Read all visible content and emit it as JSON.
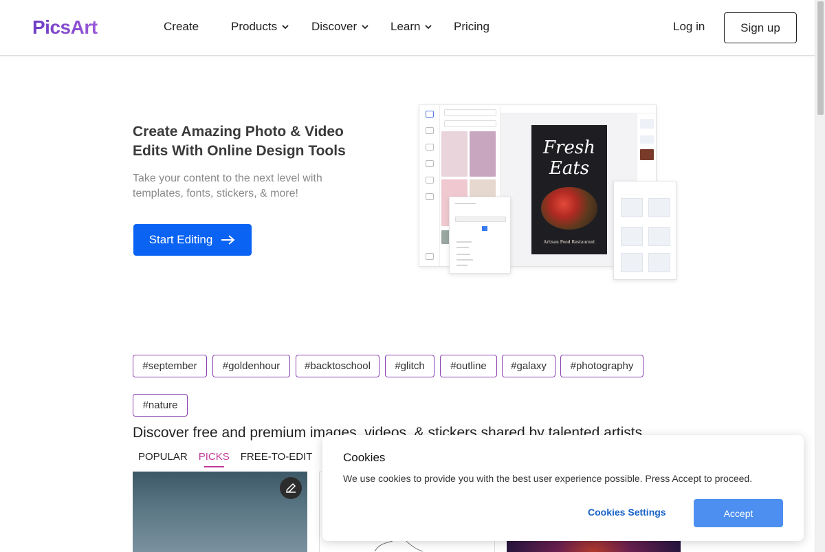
{
  "header": {
    "logo": "PicsArt",
    "nav": [
      {
        "label": "Create",
        "has_dropdown": false
      },
      {
        "label": "Products",
        "has_dropdown": true
      },
      {
        "label": "Discover",
        "has_dropdown": true
      },
      {
        "label": "Learn",
        "has_dropdown": true
      },
      {
        "label": "Pricing",
        "has_dropdown": false
      }
    ],
    "login_label": "Log in",
    "signup_label": "Sign up"
  },
  "hero": {
    "title": "Create Amazing Photo & Video Edits With Online Design Tools",
    "subtitle": "Take your content to the next level with templates, fonts, stickers, & more!",
    "cta_label": "Start Editing",
    "mockup": {
      "poster_title": "Fresh Eats",
      "poster_footer": "Artisan Food Restaurant"
    }
  },
  "tags": [
    "#september",
    "#goldenhour",
    "#backtoschool",
    "#glitch",
    "#outline",
    "#galaxy",
    "#photography",
    "#nature"
  ],
  "discover": {
    "title": "Discover free and premium images, videos, & stickers shared by talented artists",
    "tabs": [
      {
        "label": "POPULAR",
        "active": false
      },
      {
        "label": "PICKS",
        "active": true
      },
      {
        "label": "FREE-TO-EDIT",
        "active": false
      }
    ]
  },
  "cookie": {
    "title": "Cookies",
    "text": "We use cookies to provide you with the best user experience possible. Press Accept to proceed.",
    "settings_label": "Cookies Settings",
    "accept_label": "Accept"
  },
  "colors": {
    "brand_purple": "#7a45c9",
    "primary_blue": "#0a63f2",
    "tag_border": "#8a3fb0",
    "active_tab": "#c23a9b",
    "accept_blue": "#4c8ff0"
  }
}
